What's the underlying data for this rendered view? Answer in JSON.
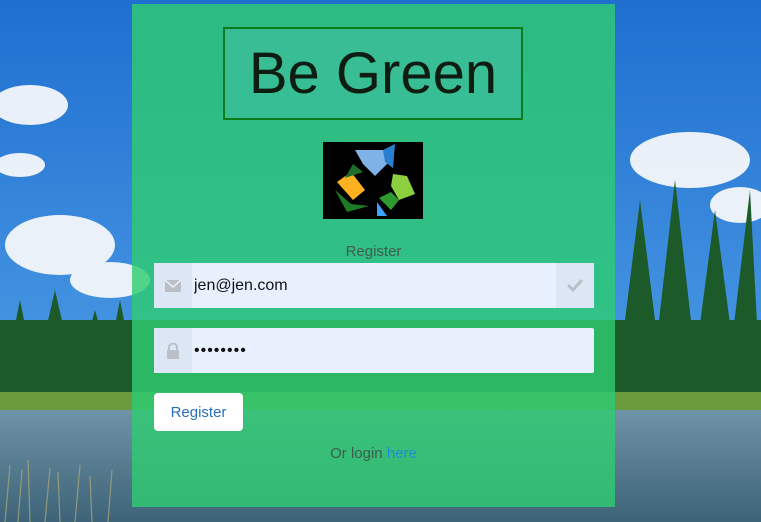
{
  "app": {
    "title": "Be Green"
  },
  "form": {
    "heading": "Register",
    "email": {
      "value": "jen@jen.com",
      "icon": "envelope-icon",
      "status_icon": "checkmark-icon"
    },
    "password": {
      "value": "••••••••",
      "icon": "lock-icon"
    },
    "submit_label": "Register",
    "login_prefix": "Or login",
    "login_link": "here"
  },
  "logo": {
    "icon": "recycle-icon"
  },
  "colors": {
    "panel": "#2ecc71",
    "title_border": "#0a7d1a",
    "link": "#1f8bd9",
    "button_text": "#2a6fb8"
  }
}
